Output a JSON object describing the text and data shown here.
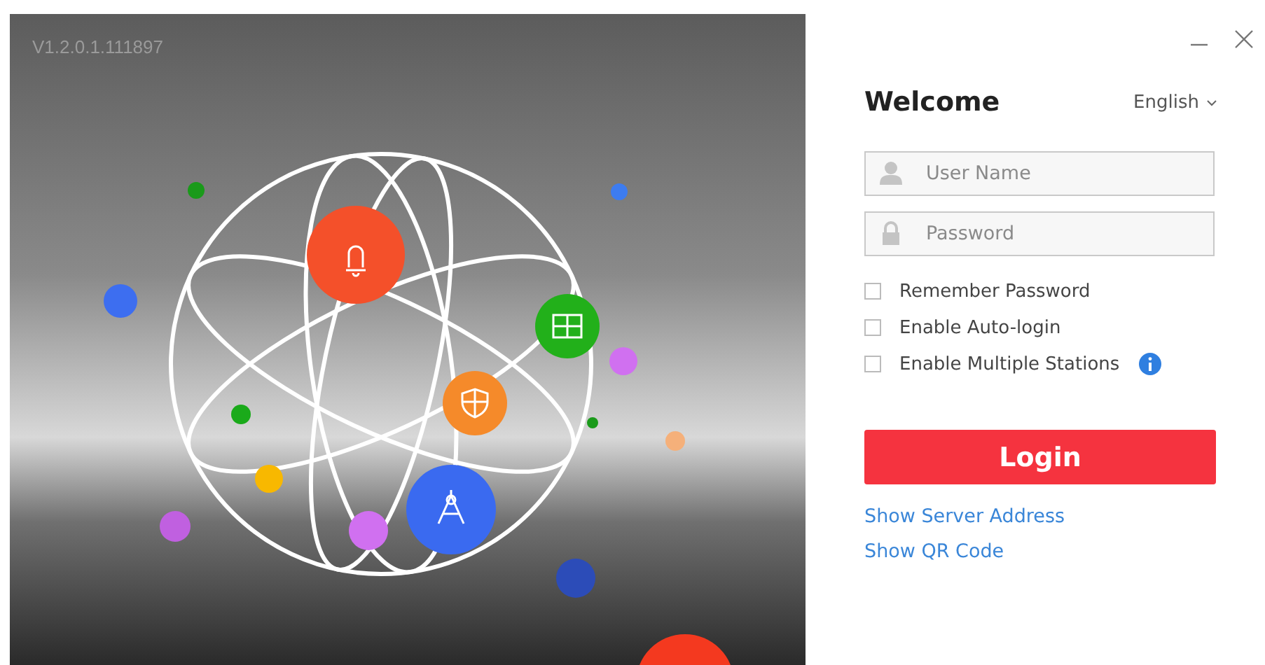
{
  "version": "V1.2.0.1.111897",
  "window_controls": [
    {
      "kind": "minimize"
    },
    {
      "kind": "close"
    }
  ],
  "title": "Welcome",
  "language": {
    "label": "English"
  },
  "fields": [
    {
      "kind": "user",
      "placeholder": "User Name"
    },
    {
      "kind": "password",
      "placeholder": "Password"
    }
  ],
  "options": [
    {
      "label": "Remember Password",
      "checked": false,
      "info": false
    },
    {
      "label": "Enable Auto-login",
      "checked": false,
      "info": false
    },
    {
      "label": "Enable Multiple Stations",
      "checked": false,
      "info": true
    }
  ],
  "login_button": "Login",
  "links": [
    "Show Server Address",
    "Show QR Code"
  ]
}
